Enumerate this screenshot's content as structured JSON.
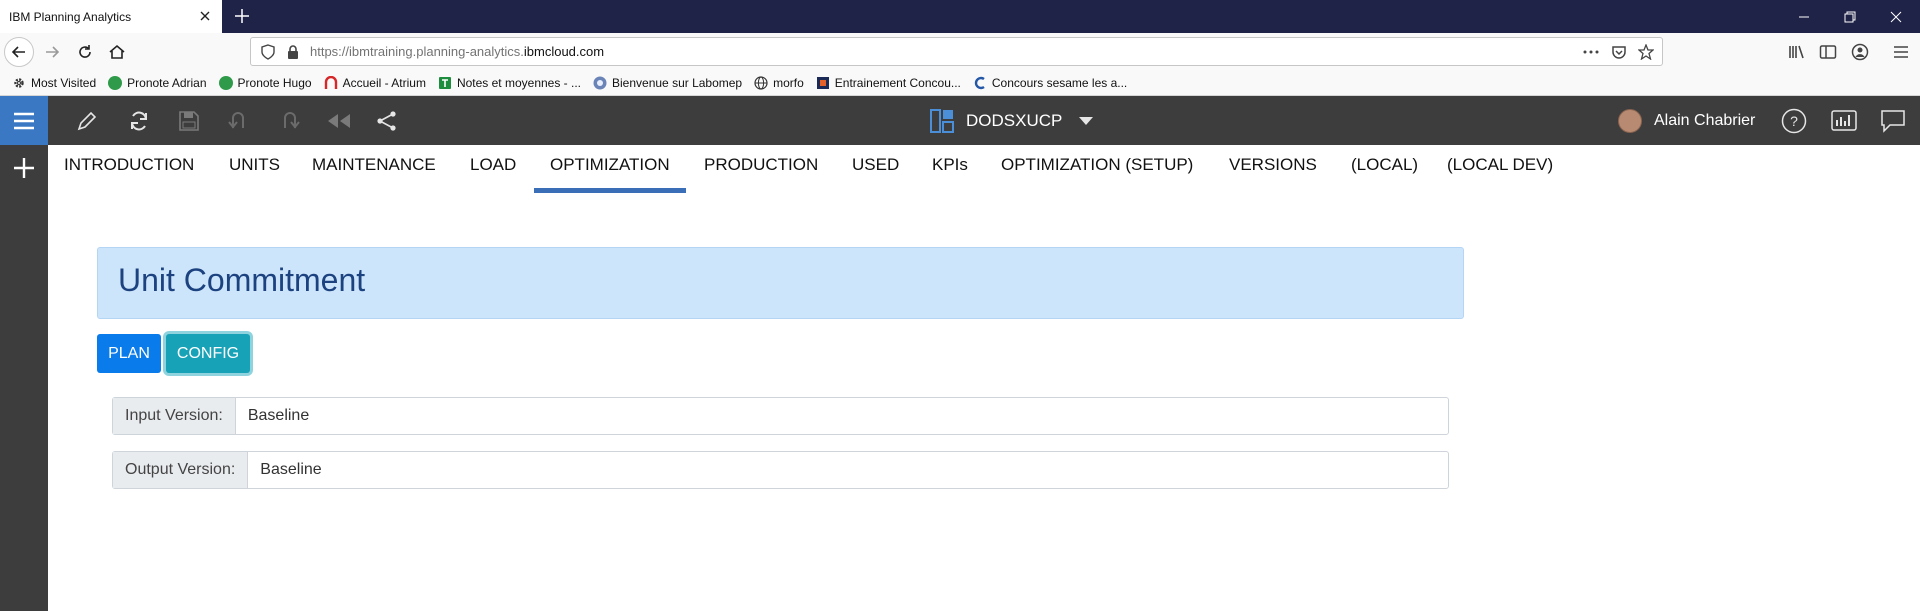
{
  "browser": {
    "tab_title": "IBM Planning Analytics",
    "url_prefix": "https://ibmtraining.planning-analytics.",
    "url_host": "ibmcloud.com",
    "bookmarks": [
      {
        "label": "Most Visited",
        "icon": "gear-icon"
      },
      {
        "label": "Pronote Adrian",
        "icon": "pronote-icon"
      },
      {
        "label": "Pronote Hugo",
        "icon": "pronote-icon"
      },
      {
        "label": "Accueil - Atrium",
        "icon": "atrium-icon"
      },
      {
        "label": "Notes et moyennes - ...",
        "icon": "sheet-icon"
      },
      {
        "label": "Bienvenue sur Labomep",
        "icon": "labomep-icon"
      },
      {
        "label": "morfo",
        "icon": "globe-icon"
      },
      {
        "label": "Entrainement Concou...",
        "icon": "concours-icon"
      },
      {
        "label": "Concours sesame les a...",
        "icon": "sesame-icon"
      }
    ]
  },
  "app": {
    "workspace": "DODSXUCP",
    "user_name": "Alain Chabrier",
    "tabs": [
      "INTRODUCTION",
      "UNITS",
      "MAINTENANCE",
      "LOAD",
      "OPTIMIZATION",
      "PRODUCTION",
      "USED",
      "KPIs",
      "OPTIMIZATION (SETUP)",
      "VERSIONS",
      "(LOCAL)",
      "(LOCAL DEV)"
    ],
    "active_tab": "OPTIMIZATION"
  },
  "content": {
    "title": "Unit Commitment",
    "plan_label": "PLAN",
    "config_label": "CONFIG",
    "input_version_label": "Input Version:",
    "input_version_value": "Baseline",
    "output_version_label": "Output Version:",
    "output_version_value": "Baseline"
  },
  "colors": {
    "tabstrip": "#1f2347",
    "app_toolbar": "#3d3d3d",
    "accent": "#3a78c3",
    "banner_bg": "#cde5fb",
    "banner_text": "#1c4380",
    "plan_button": "#0a7bea",
    "config_button": "#17a2b8"
  }
}
